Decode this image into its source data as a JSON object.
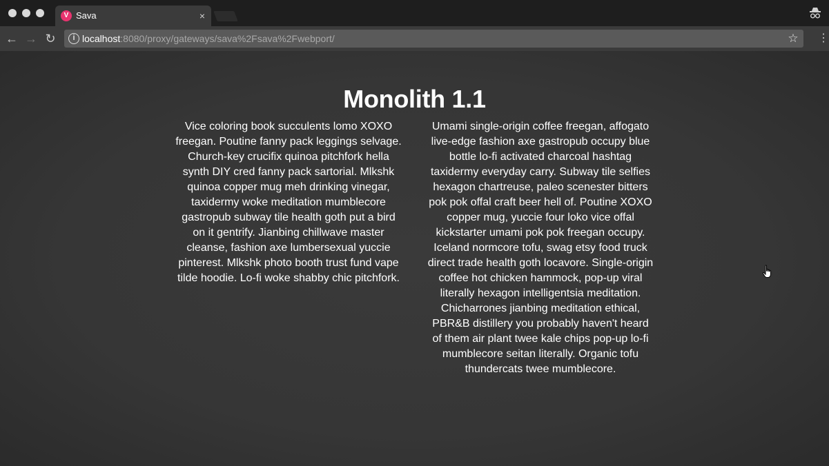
{
  "browser": {
    "tab": {
      "title": "Sava",
      "favicon_letter": "V",
      "close_glyph": "×"
    },
    "toolbar": {
      "back_glyph": "←",
      "forward_glyph": "→",
      "reload_glyph": "↻",
      "url_host": "localhost",
      "url_rest": ":8080/proxy/gateways/sava%2Fsava%2Fwebport/",
      "star_glyph": "☆",
      "menu_glyph": "⋮"
    },
    "colors": {
      "favicon": "#e8336f",
      "page_bg": "#363636"
    }
  },
  "page": {
    "title": "Monolith 1.1",
    "left_paragraph": "Vice coloring book succulents lomo XOXO freegan. Poutine fanny pack leggings selvage. Church-key crucifix quinoa pitchfork hella synth DIY cred fanny pack sartorial. Mlkshk quinoa copper mug meh drinking vinegar, taxidermy woke meditation mumblecore gastropub subway tile health goth put a bird on it gentrify. Jianbing chillwave master cleanse, fashion axe lumbersexual yuccie pinterest. Mlkshk photo booth trust fund vape tilde hoodie. Lo-fi woke shabby chic pitchfork.",
    "right_paragraph": "Umami single-origin coffee freegan, affogato live-edge fashion axe gastropub occupy blue bottle lo-fi activated charcoal hashtag taxidermy everyday carry. Subway tile selfies hexagon chartreuse, paleo scenester bitters pok pok offal craft beer hell of. Poutine XOXO copper mug, yuccie four loko vice offal kickstarter umami pok pok freegan occupy. Iceland normcore tofu, swag etsy food truck direct trade health goth locavore. Single-origin coffee hot chicken hammock, pop-up viral literally hexagon intelligentsia meditation. Chicharrones jianbing meditation ethical, PBR&B distillery you probably haven't heard of them air plant twee kale chips pop-up lo-fi mumblecore seitan literally. Organic tofu thundercats twee mumblecore."
  }
}
